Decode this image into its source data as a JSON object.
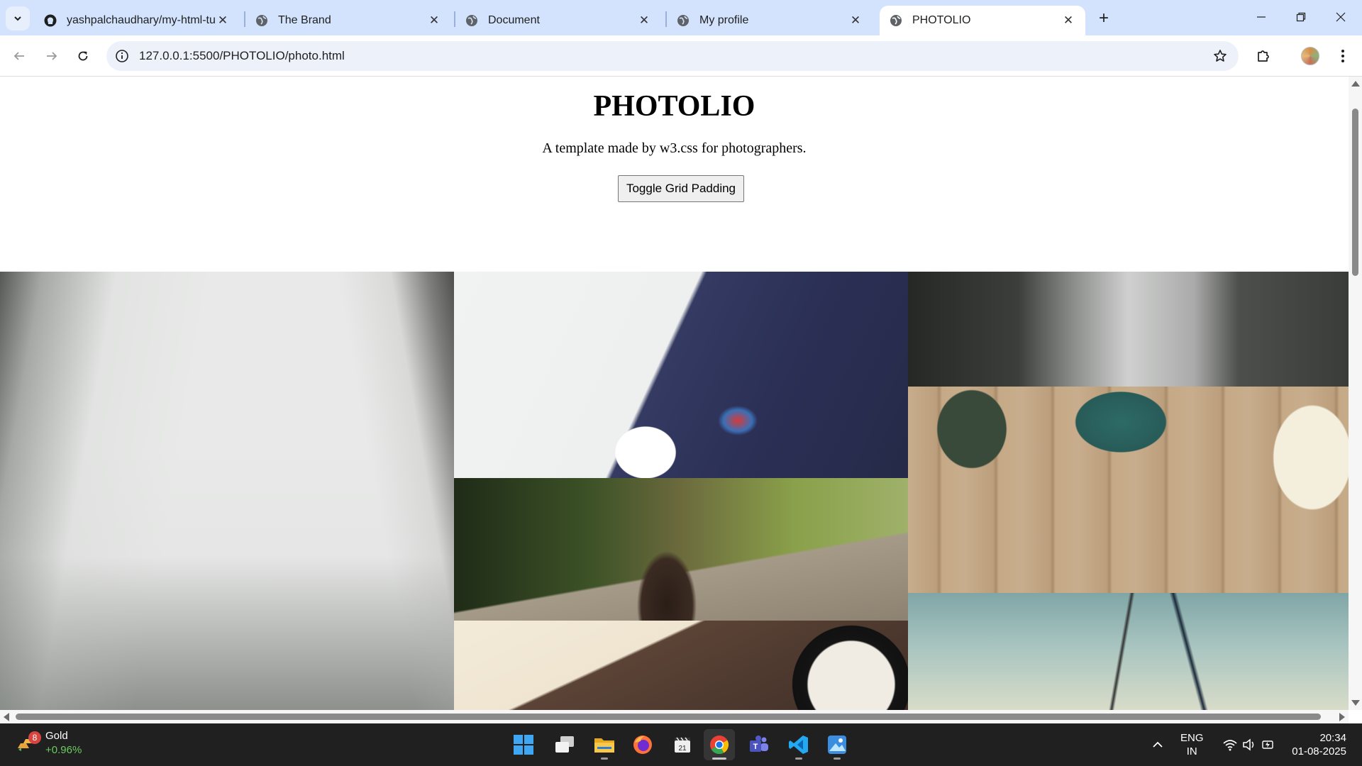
{
  "browser": {
    "tabs": [
      {
        "title": "yashpalchaudhary/my-html-tut",
        "favicon": "github-icon"
      },
      {
        "title": "The Brand",
        "favicon": "globe-icon"
      },
      {
        "title": "Document",
        "favicon": "globe-icon"
      },
      {
        "title": "My profile",
        "favicon": "globe-icon"
      },
      {
        "title": "PHOTOLIO",
        "favicon": "globe-icon",
        "active": true
      }
    ],
    "url": "127.0.0.1:5500/PHOTOLIO/photo.html"
  },
  "page": {
    "title": "PHOTOLIO",
    "subtitle": "A template made by w3.css for photographers.",
    "toggle_button": "Toggle Grid Padding"
  },
  "taskbar": {
    "widget": {
      "badge": "8",
      "name": "Gold",
      "change": "+0.96%"
    },
    "apps": [
      "start-icon",
      "task-view-icon",
      "file-explorer-icon",
      "firefox-icon",
      "clipchamp-icon",
      "chrome-icon",
      "teams-icon",
      "vscode-icon",
      "photos-icon"
    ],
    "language": {
      "line1": "ENG",
      "line2": "IN"
    },
    "time": "20:34",
    "date": "01-08-2025"
  },
  "colors": {
    "tabstrip": "#d3e3fd",
    "omnibox": "#edf2fa",
    "taskbar": "#202020",
    "gain": "#6ccb5f"
  }
}
